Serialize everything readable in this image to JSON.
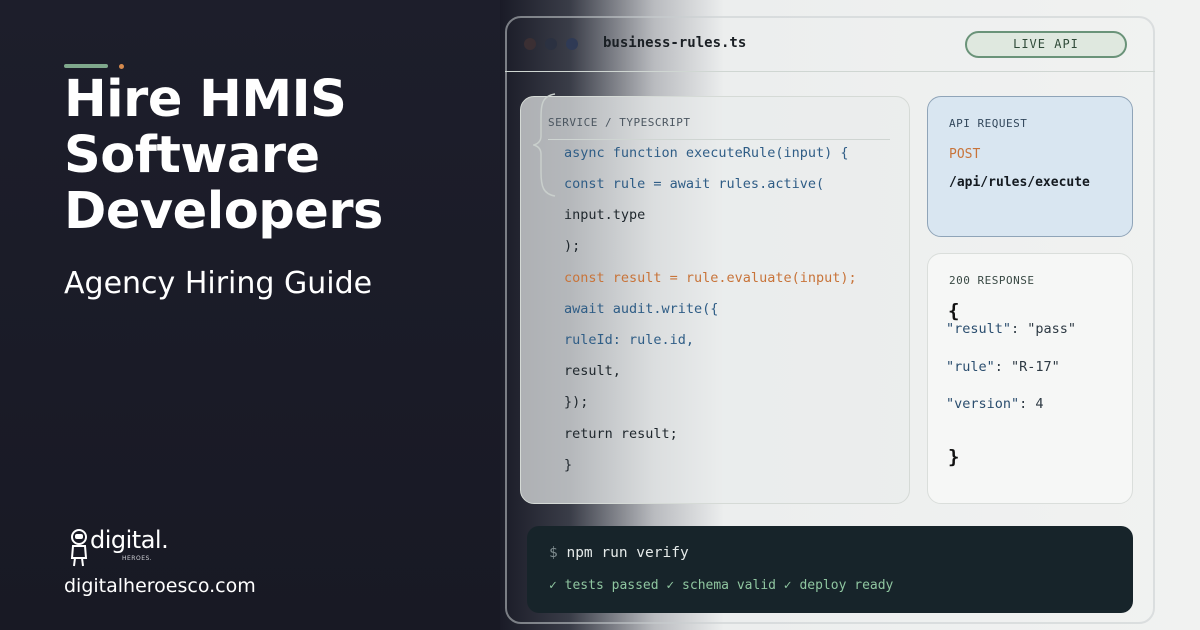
{
  "hero": {
    "headline": "Hire HMIS Software Developers",
    "subtitle": "Agency Hiring Guide",
    "brand": {
      "logo_text": "digital.",
      "logo_sub": "HEROES."
    },
    "site_url": "digitalheroesco.com"
  },
  "window": {
    "filename": "business-rules.ts",
    "badge": "LIVE API"
  },
  "code": {
    "label": "SERVICE / TYPESCRIPT",
    "lines": [
      "async function executeRule(input) {",
      "const rule = await rules.active(",
      "input.type",
      ");",
      "const result = rule.evaluate(input);",
      "await audit.write({",
      "ruleId: rule.id,",
      "result,",
      "});",
      "return result;",
      "}"
    ]
  },
  "api_request": {
    "label": "API REQUEST",
    "method": "POST",
    "path": "/api/rules/execute"
  },
  "response": {
    "label": "200 RESPONSE",
    "open_brace": "{",
    "close_brace": "}",
    "rows": [
      {
        "key": "\"result\"",
        "value": ": \"pass\""
      },
      {
        "key": "\"rule\"",
        "value": ": \"R-17\""
      },
      {
        "key": "\"version\"",
        "value": ": 4"
      }
    ]
  },
  "terminal": {
    "prompt": "$",
    "command": "npm run verify",
    "status": "✓ tests passed ✓ schema valid ✓ deploy ready"
  },
  "colors": {
    "accent_green": "#7fa88c",
    "accent_orange": "#d58a4d",
    "keyword_blue": "#2f5d86",
    "code_orange": "#c8743a",
    "terminal_bg": "#17242a"
  }
}
